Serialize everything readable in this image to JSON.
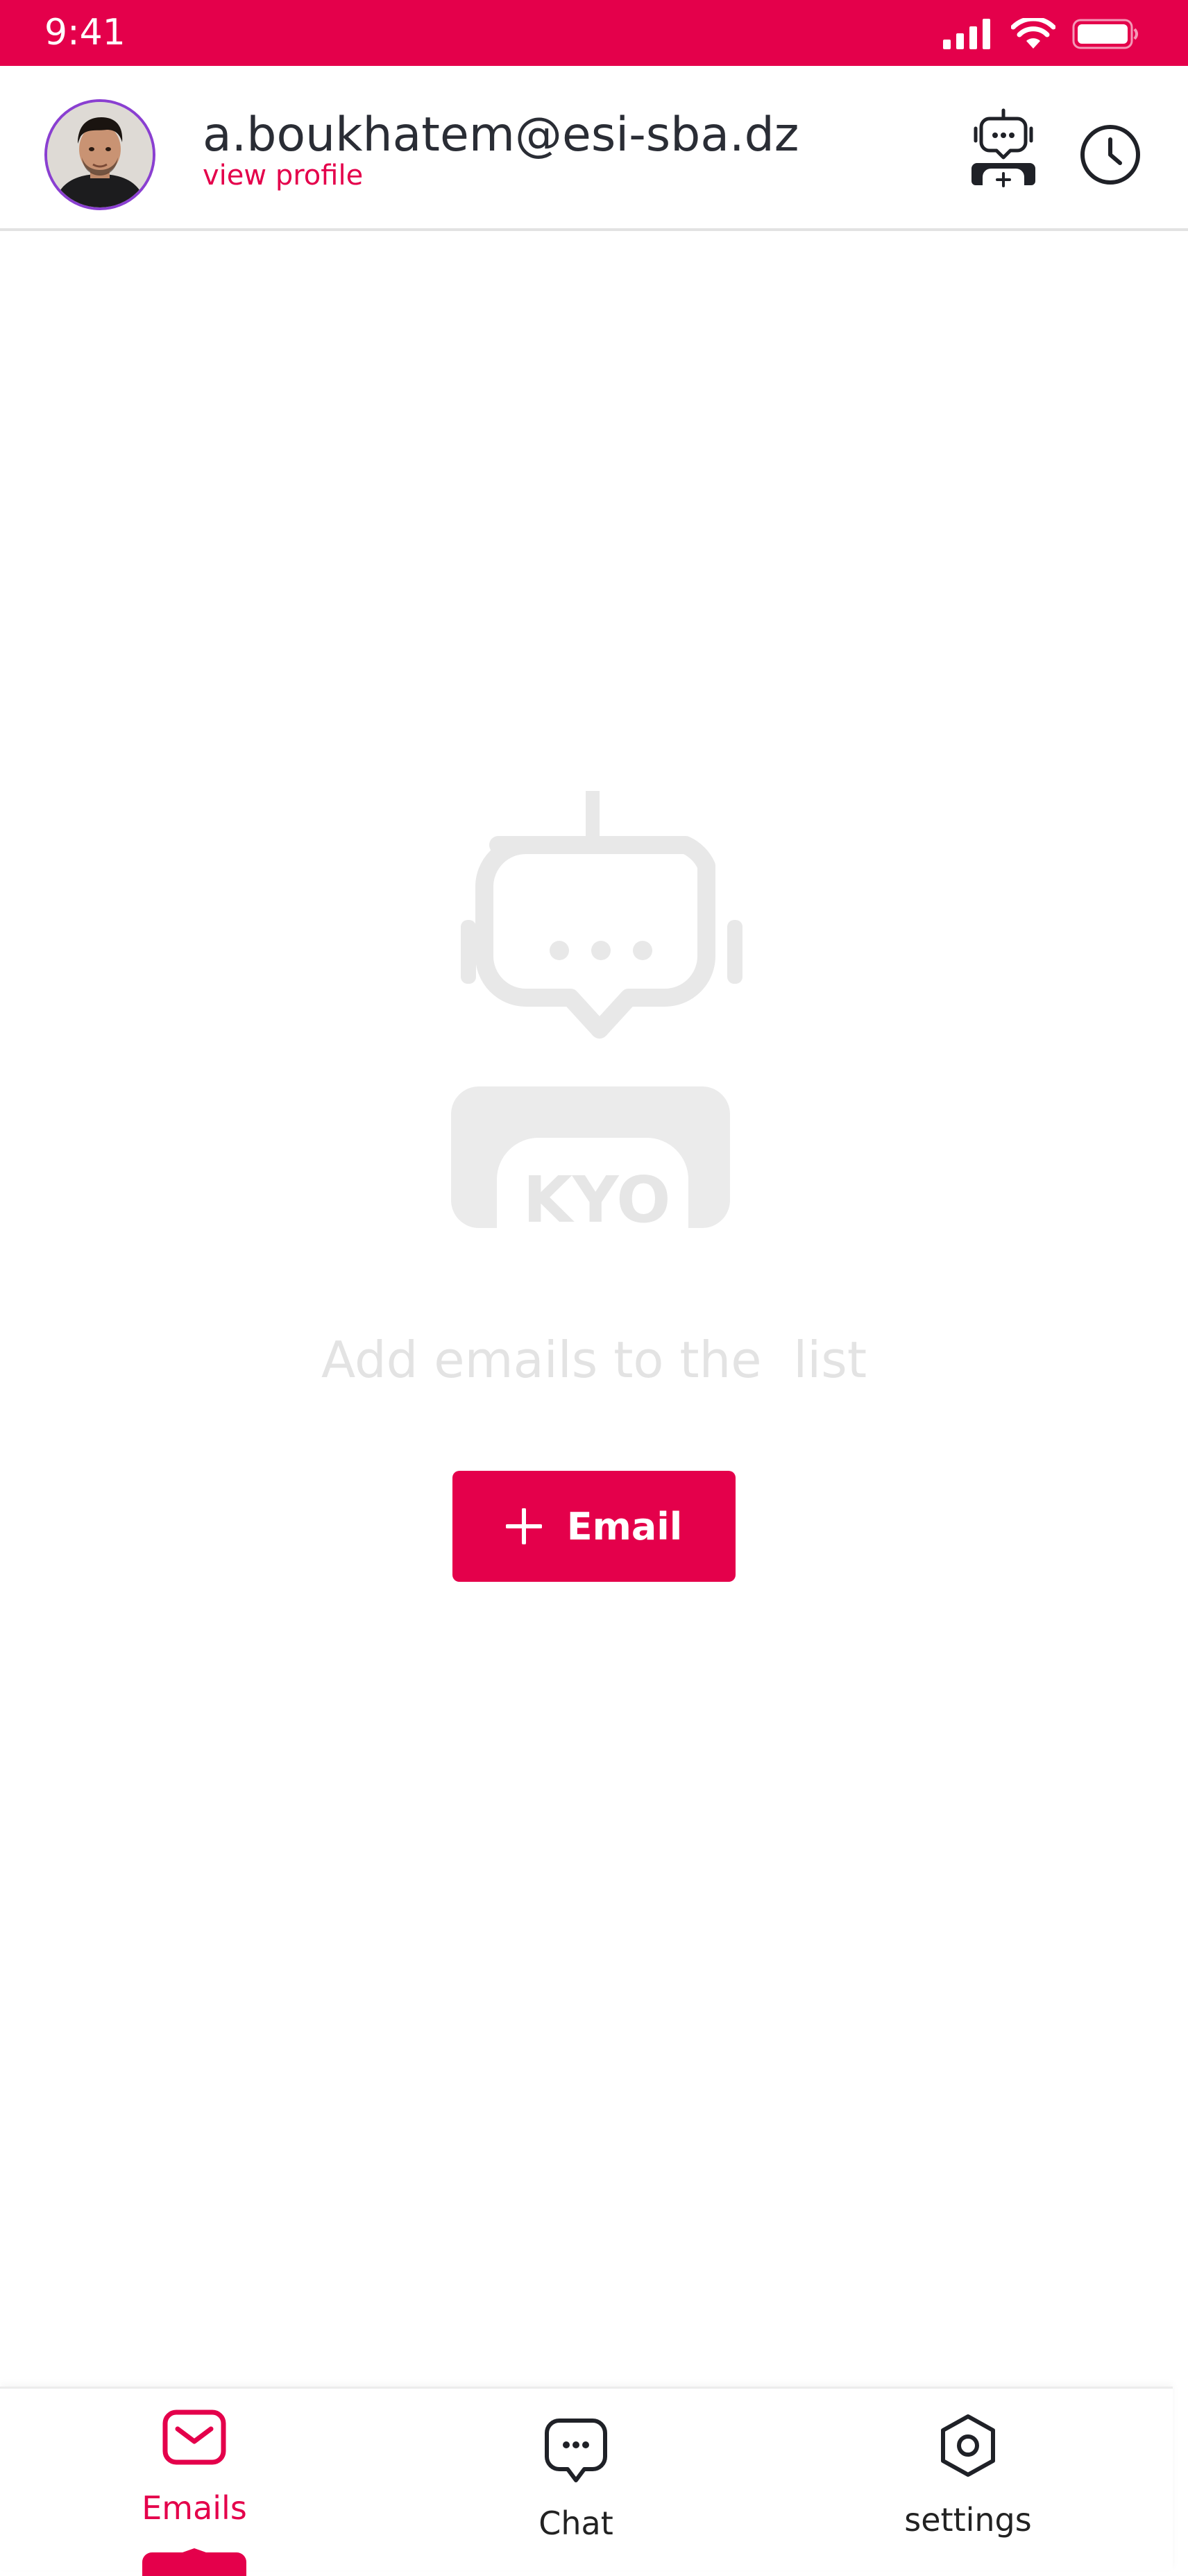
{
  "status_bar": {
    "time": "9:41",
    "icons": [
      "signal-icon",
      "wifi-icon",
      "battery-icon"
    ]
  },
  "header": {
    "email": "a.boukhatem@esi-sba.dz",
    "view_profile_label": "view profile",
    "actions": [
      "robot-add-icon",
      "clock-icon"
    ]
  },
  "empty_state": {
    "message": "Add emails to the  list",
    "illustration_text": "KYO",
    "add_button_label": "Email"
  },
  "bottom_nav": {
    "items": [
      {
        "label": "Emails",
        "icon": "mail-icon",
        "active": true
      },
      {
        "label": "Chat",
        "icon": "chat-icon",
        "active": false
      },
      {
        "label": "settings",
        "icon": "settings-icon",
        "active": false
      }
    ]
  },
  "colors": {
    "accent": "#e4004b",
    "text_dark": "#2a2d35",
    "empty_gray": "#e3e3e3",
    "avatar_ring": "#8a3fd1"
  }
}
